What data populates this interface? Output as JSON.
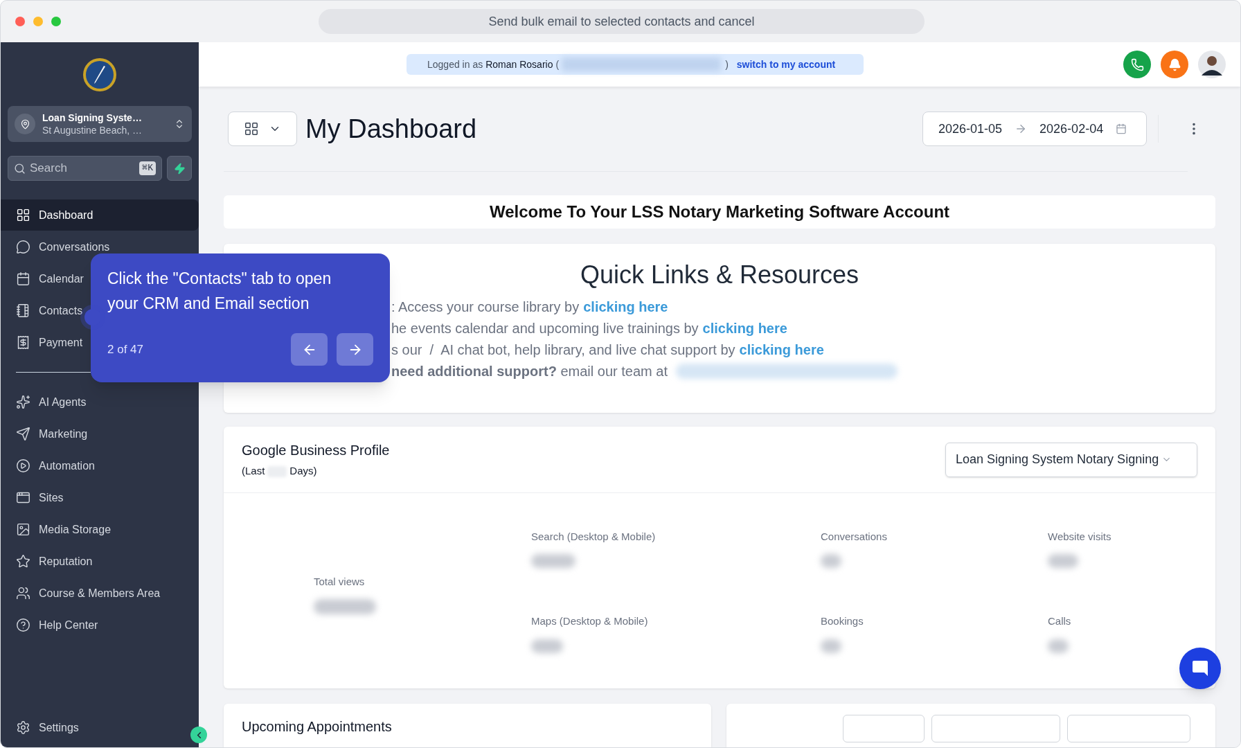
{
  "browser": {
    "address_text": "Send bulk email to selected contacts and cancel"
  },
  "sidebar": {
    "location": {
      "name": "Loan Signing Syste…",
      "address": "St Augustine Beach, …"
    },
    "search": {
      "placeholder": "Search",
      "shortcut": "⌘K"
    },
    "main_items": [
      {
        "label": "Dashboard",
        "selected": true
      },
      {
        "label": "Conversations",
        "selected": false
      },
      {
        "label": "Calendar",
        "selected": false
      },
      {
        "label": "Contacts",
        "selected": false
      },
      {
        "label": "Payment",
        "selected": false
      }
    ],
    "more_items": [
      {
        "label": "AI Agents",
        "selected": false
      },
      {
        "label": "Marketing",
        "selected": false
      },
      {
        "label": "Automation",
        "selected": false
      },
      {
        "label": "Sites",
        "selected": false
      },
      {
        "label": "Media Storage",
        "selected": false
      },
      {
        "label": "Reputation",
        "selected": false
      },
      {
        "label": "Course & Members Area",
        "selected": false
      },
      {
        "label": "Help Center",
        "selected": false
      }
    ],
    "settings": {
      "label": "Settings",
      "selected": false
    }
  },
  "header": {
    "logged_in_prefix": "Logged in as",
    "user_name": "Roman Rosario",
    "open_paren": "(",
    "close_paren": ")",
    "switch_link": "switch to my account"
  },
  "page": {
    "title": "My Dashboard",
    "date_from": "2026-01-05",
    "date_to": "2026-02-04"
  },
  "welcome": {
    "title": "Welcome To Your LSS Notary Marketing Software Account"
  },
  "quick_links": {
    "title": "Quick Links & Resources",
    "lines": [
      {
        "text": ": Access your course library by",
        "link": "clicking here"
      },
      {
        "text": "he events calendar and upcoming live trainings by",
        "link": "clicking here"
      },
      {
        "text": "s our  /  AI chat bot, help library, and live chat support by",
        "link": "clicking here"
      },
      {
        "text": "**need additional support?** email our team at"
      }
    ]
  },
  "business_profile": {
    "title": "Google Business Profile",
    "period_start": "(Last",
    "period_end": "Days)",
    "location_select": "Loan Signing System Notary Signing",
    "stats": [
      {
        "label": "Total views",
        "kind": "main"
      },
      {
        "label": "Search (Desktop & Mobile)",
        "kind": "small"
      },
      {
        "label": "Conversations",
        "kind": "small"
      },
      {
        "label": "Website visits",
        "kind": "small"
      },
      {
        "label": "Maps (Desktop & Mobile)",
        "kind": "small"
      },
      {
        "label": "Bookings",
        "kind": "small"
      },
      {
        "label": "Calls",
        "kind": "small"
      }
    ]
  },
  "appointments": {
    "title": "Upcoming Appointments"
  },
  "tour": {
    "text": "Click the \"Contacts\" tab to open your CRM and Email section",
    "counter": "2 of 47"
  }
}
